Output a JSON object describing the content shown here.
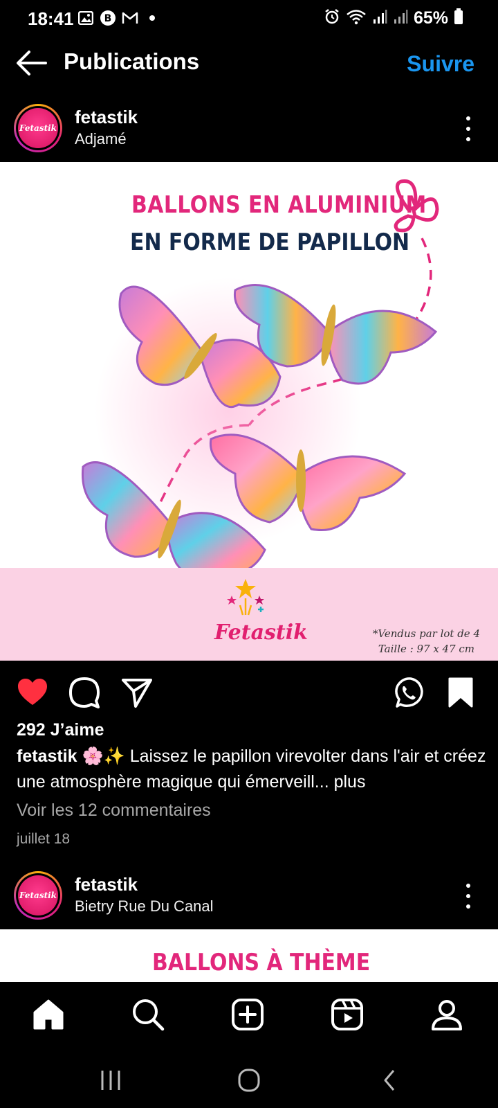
{
  "status_bar": {
    "time": "18:41",
    "battery": "65%",
    "left_icons": [
      "image-icon",
      "b-badge-icon",
      "gmail-icon",
      "dot-icon"
    ],
    "right_icons": [
      "alarm-icon",
      "wifi-icon",
      "signal-icon",
      "signal-icon",
      "battery-icon"
    ]
  },
  "header": {
    "title": "Publications",
    "follow_label": "Suivre"
  },
  "post1": {
    "username": "fetastik",
    "location": "Adjamé",
    "avatar_text": "Fetastik",
    "image": {
      "title_line1": "BALLONS EN ALUMINIUM",
      "title_line2": "EN FORME DE PAPILLON",
      "brand": "Fetastik",
      "note_line1": "*Vendus par lot de 4",
      "note_line2": "Taille : 97 x 47 cm"
    },
    "liked": true,
    "saved": true,
    "likes_text": "292 J’aime",
    "caption_user": "fetastik",
    "caption_text": " 🌸✨ Laissez le papillon virevolter dans l'air et créez une atmosphère magique qui émerveill...",
    "caption_more": " plus",
    "comments_link": "Voir les 12 commentaires",
    "date": "juillet 18"
  },
  "post2": {
    "username": "fetastik",
    "location": "Bietry Rue Du Canal",
    "avatar_text": "Fetastik",
    "image_title": "BALLONS À THÈME"
  },
  "colors": {
    "accent_blue": "#1a96f0",
    "like_red": "#ff3040",
    "brand_pink": "#e2277b",
    "navy": "#132a4b"
  },
  "bottom_nav": [
    "home-icon",
    "search-icon",
    "create-icon",
    "reels-icon",
    "profile-icon"
  ],
  "system_nav": [
    "recents-icon",
    "home-circle-icon",
    "back-chevron-icon"
  ]
}
